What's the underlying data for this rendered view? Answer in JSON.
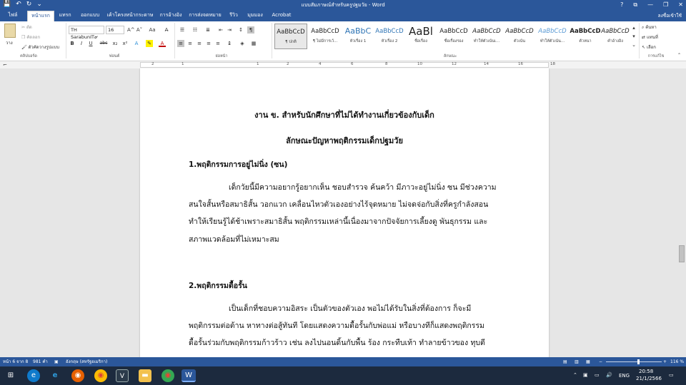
{
  "window": {
    "title": "แบบสัมภาษณ์สำหรับครูปฐมวัย - Word",
    "help": "?",
    "min": "—",
    "max": "❐",
    "close": "✕",
    "restore": "⧉"
  },
  "qat": {
    "save": "💾",
    "undo": "↶",
    "redo": "↻",
    "more": "⌄"
  },
  "tabs": {
    "file": "ไฟล์",
    "items": [
      "หน้าแรก",
      "แทรก",
      "ออกแบบ",
      "เค้าโครงหน้ากระดาษ",
      "การอ้างอิง",
      "การส่งจดหมาย",
      "รีวิว",
      "มุมมอง",
      "Acrobat"
    ],
    "active": 0,
    "user": "ลงชื่อเข้าใช้"
  },
  "ribbon": {
    "clipboard": {
      "paste": "วาง",
      "cut": "ตัด",
      "copy": "คัดลอก",
      "painter": "ตัวคัดวางรูปแบบ",
      "label": "คลิปบอร์ด"
    },
    "font": {
      "name": "TH SarabunIT๙",
      "size": "16",
      "grow": "A^",
      "shrink": "A˅",
      "case": "Aa",
      "clear": "A̶",
      "bold": "B",
      "italic": "I",
      "underline": "U",
      "strike": "abc",
      "sub": "x₂",
      "sup": "x²",
      "effects": "A",
      "highlight": "✎",
      "color": "A",
      "label": "ฟอนต์"
    },
    "paragraph": {
      "label": "ย่อหน้า",
      "pilcrow": "¶"
    },
    "styles": {
      "label": "ลักษณะ",
      "items": [
        {
          "preview": "AaBbCcD",
          "name": "¶ ปกติ"
        },
        {
          "preview": "AaBbCcD",
          "name": "¶ ไม่มีการเว้..."
        },
        {
          "preview": "AaBbC",
          "name": "หัวเรื่อง 1"
        },
        {
          "preview": "AaBbCcD",
          "name": "หัวเรื่อง 2"
        },
        {
          "preview": "AaBl",
          "name": "ชื่อเรื่อง"
        },
        {
          "preview": "AaBbCcD",
          "name": "ชื่อเรื่องรอง"
        },
        {
          "preview": "AaBbCcD",
          "name": "ทำให้ตัวเน้นเ..."
        },
        {
          "preview": "AaBbCcD",
          "name": "ตัวเน้น"
        },
        {
          "preview": "AaBbCcD",
          "name": "ทำให้ตัวเน้น..."
        },
        {
          "preview": "AaBbCcD",
          "name": "ตัวหนา"
        },
        {
          "preview": "AaBbCcD",
          "name": "คำอ้างอิง"
        }
      ]
    },
    "editing": {
      "find": "ค้นหา",
      "replace": "แทนที่",
      "select": "เลือก",
      "label": "การแก้ไข"
    }
  },
  "ruler": {
    "numbers": [
      "2",
      "1",
      "1",
      "2",
      "4",
      "6",
      "8",
      "10",
      "12",
      "14",
      "16",
      "18"
    ]
  },
  "document": {
    "heading1": "งาน ข.  สำหรับนักศึกษาที่ไม่ได้ทำงานเกี่ยวข้องกับเด็ก",
    "heading2": "ลักษณะปัญหาพฤติกรรมเด็กปฐมวัย",
    "section1": {
      "title": "1.พฤติกรรมการอยู่ไม่นิ่ง (ซน)",
      "lines": [
        "เด็กวัยนี้มีความอยากรู้อยากเห็น ชอบสำรวจ ค้นคว้า มีภาวะอยู่ไม่นิ่ง ซน มีช่วงความ",
        "สนใจสั้นหรือสมาธิสั้น วอกแวก เคลื่อนไหวตัวเองอย่างไร้จุดหมาย ไม่จดจ่อกับสิ่งที่ครูกำลังสอน",
        "ทำให้เรียนรู้ได้ช้าเพราะสมาธิสั้น พฤติกรรมเหล่านี้เนื่องมาจากปัจจัยการเลี้ยงดู พันธุกรรม และ",
        "สภาพแวดล้อมที่ไม่เหมาะสม"
      ]
    },
    "section2": {
      "title": "2.พฤติกรรมดื้อรั้น",
      "lines": [
        "เป็นเด็กที่ชอบความอิสระ เป็นตัวของตัวเอง พอไม่ได้รับในสิ่งที่ต้องการ ก็จะมี",
        "พฤติกรรมต่อต้าน หาทางต่อสู้ทันที โดยแสดงความดื้อรั้นกับพ่อแม่ หรือบางทีก็แสดงพฤติกรรม",
        "ดื้อรั้นร่วมกับพฤติกรรมก้าวร้าว เช่น ลงไปนอนดิ้นกับพื้น ร้อง กระทืบเท้า ทำลายข้าวของ ทุบตี"
      ]
    }
  },
  "status": {
    "page": "หน้า 6 จาก 8",
    "words": "981 คำ",
    "lang": "อังกฤษ (สหรัฐอเมริกา)",
    "zoom": "116 %",
    "zoom_fraction": 0.56
  },
  "taskbar": {
    "time": "20:58",
    "date": "21/1/2566",
    "lang": "ENG",
    "apps": [
      "start",
      "search",
      "edge",
      "ie",
      "firefox",
      "chrome",
      "v",
      "folder",
      "chrome2",
      "word"
    ]
  }
}
